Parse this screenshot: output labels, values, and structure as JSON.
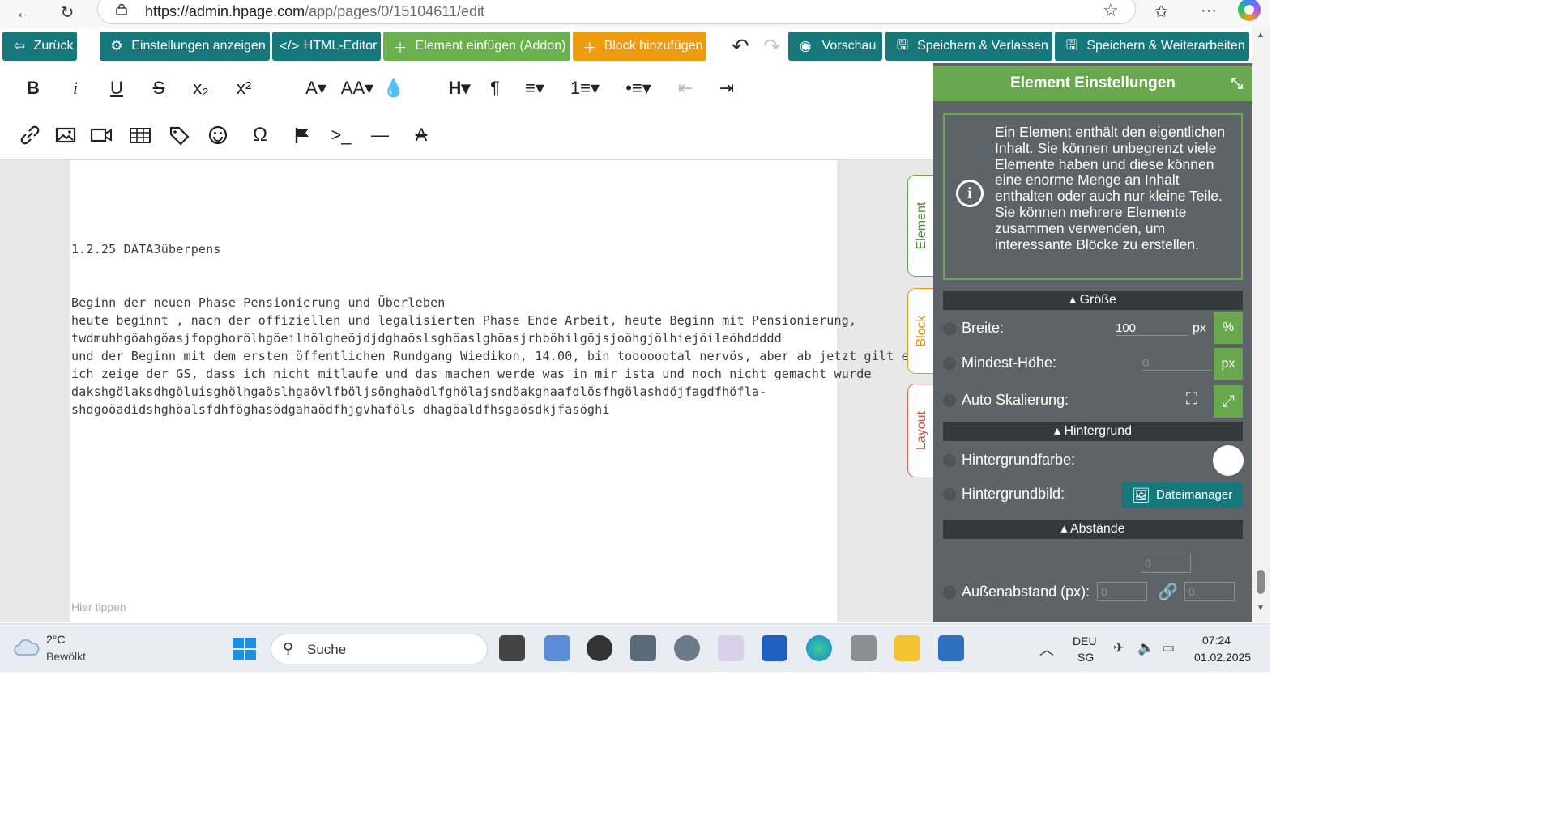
{
  "browser": {
    "url_host": "https://admin.hpage.com",
    "url_path": "/app/pages/0/15104611/edit"
  },
  "toolbar": {
    "back": "Zurück",
    "settings": "Einstellungen anzeigen",
    "html_editor": "HTML-Editor",
    "insert_element": "Element einfügen (Addon)",
    "add_block": "Block hinzufügen",
    "preview": "Vorschau",
    "save_exit": "Speichern & Verlassen",
    "save_continue": "Speichern & Weiterarbeiten"
  },
  "format": {
    "row1": [
      "B",
      "i",
      "U",
      "S",
      "x₂",
      "x²",
      "A▾",
      "AA▾",
      "💧",
      "H▾",
      "¶",
      "≡▾",
      "1≡▾",
      "•≡▾",
      "⇤",
      "⇥"
    ],
    "row2_names": [
      "link",
      "image",
      "video",
      "table",
      "tag",
      "emoji",
      "omega",
      "flag",
      "code",
      "horizontal-line",
      "clear-format"
    ]
  },
  "content": {
    "heading": "1.2.25 DATA3überpens",
    "lines": [
      "Beginn der neuen Phase Pensionierung und Überleben",
      "heute beginnt , nach der offiziellen und legalisierten Phase Ende Arbeit, heute Beginn mit Pensionierung,",
      "twdmuhhgöahgöasjfopghorölhgöeilhölgheöjdjdghaöslsghöaslghöasjrhböhilgöjsjoöhgjölhiejöileöhddddd",
      "und der Beginn mit dem ersten öffentlichen Rundgang Wiedikon, 14.00, bin tooooootal nervös, aber ab jetzt gilt es machen,",
      "ich zeige der GS, dass ich nicht mitlaufe und das machen werde was in mir ista und noch nicht gemacht wurde",
      "dakshgölaksdhgöluisghölhgaöslhgaövlfböljsönghaödlfghölajsndöakghaafdlösfhgölashdöjfagdfhöfla-",
      "shdgoöadidshghöalsfdhföghasödgahaödfhjgvhaföls dhagöaldfhsgaösdkjfasöghi"
    ],
    "hint": "Hier tippen"
  },
  "side_tabs": [
    "Element",
    "Block",
    "Layout"
  ],
  "panel": {
    "title": "Element Einstellungen",
    "info": "Ein Element enthält den eigentlichen Inhalt. Sie können unbegrenzt viele Elemente haben und diese können eine enorme Menge an Inhalt enthalten oder auch nur kleine Teile. Sie können mehrere Elemente zusammen verwenden, um interessante Blöcke zu erstellen.",
    "sec_size": "Größe",
    "width_label": "Breite:",
    "width_value": "100",
    "width_unit": "px",
    "width_pct": "%",
    "minh_label": "Mindest-Höhe:",
    "minh_placeholder": "0",
    "minh_unit": "px",
    "autoscale_label": "Auto Skalierung:",
    "sec_bg": "Hintergrund",
    "bgcolor_label": "Hintergrundfarbe:",
    "bgimage_label": "Hintergrundbild:",
    "filemanager": "Dateimanager",
    "sec_spacing": "Abstände",
    "margin_label": "Außenabstand (px):",
    "margin_top": "0",
    "margin_left": "0",
    "margin_right": "0"
  },
  "taskbar": {
    "temp": "2°C",
    "weather": "Bewölkt",
    "search": "Suche",
    "lang": "DEU",
    "region": "SG",
    "time": "07:24",
    "date": "01.02.2025"
  },
  "colors": {
    "teal": "#16787a",
    "green": "#6ab04c",
    "orange": "#ef9b0f",
    "panel": "#5d6366"
  }
}
